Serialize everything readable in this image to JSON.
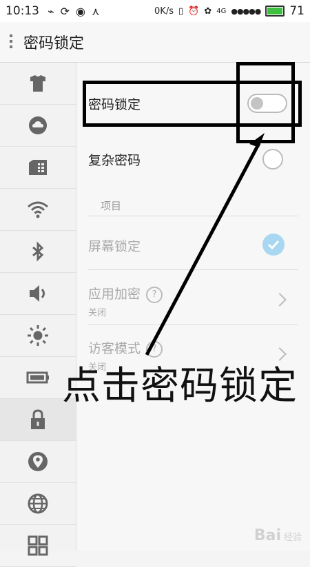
{
  "status_bar": {
    "time": "10:13",
    "speed": "0K/s",
    "network": "4G",
    "signal": "●●●●●",
    "battery_level": "71",
    "icons": [
      "usb-icon",
      "sync-icon",
      "weibo-icon",
      "share-icon",
      "vibrate-icon",
      "alarm-icon",
      "paw-icon"
    ]
  },
  "header": {
    "title": "密码锁定"
  },
  "sidebar": {
    "items": [
      {
        "icon": "theme-shirt-icon"
      },
      {
        "icon": "cloud-icon"
      },
      {
        "icon": "sim-card-icon"
      },
      {
        "icon": "wifi-icon"
      },
      {
        "icon": "bluetooth-icon"
      },
      {
        "icon": "volume-icon"
      },
      {
        "icon": "brightness-icon"
      },
      {
        "icon": "battery-icon"
      },
      {
        "icon": "lock-icon",
        "active": true
      },
      {
        "icon": "location-icon"
      },
      {
        "icon": "globe-icon"
      },
      {
        "icon": "apps-grid-icon"
      }
    ]
  },
  "settings": {
    "password_lock": {
      "label": "密码锁定",
      "enabled": false
    },
    "complex_password": {
      "label": "复杂密码",
      "checked": false
    },
    "section_title": "项目",
    "screen_lock": {
      "label": "屏幕锁定",
      "checked": true
    },
    "app_encryption": {
      "label": "应用加密",
      "help": "?",
      "status": "关闭"
    },
    "guest_mode": {
      "label": "访客模式",
      "help": "?",
      "status": "关闭"
    }
  },
  "annotation": {
    "text": "点击密码锁定"
  },
  "watermark": {
    "brand": "Bai",
    "suffix": "经验"
  },
  "colors": {
    "check_bg": "#a7d7f1",
    "battery_green": "#3fbf3f"
  }
}
